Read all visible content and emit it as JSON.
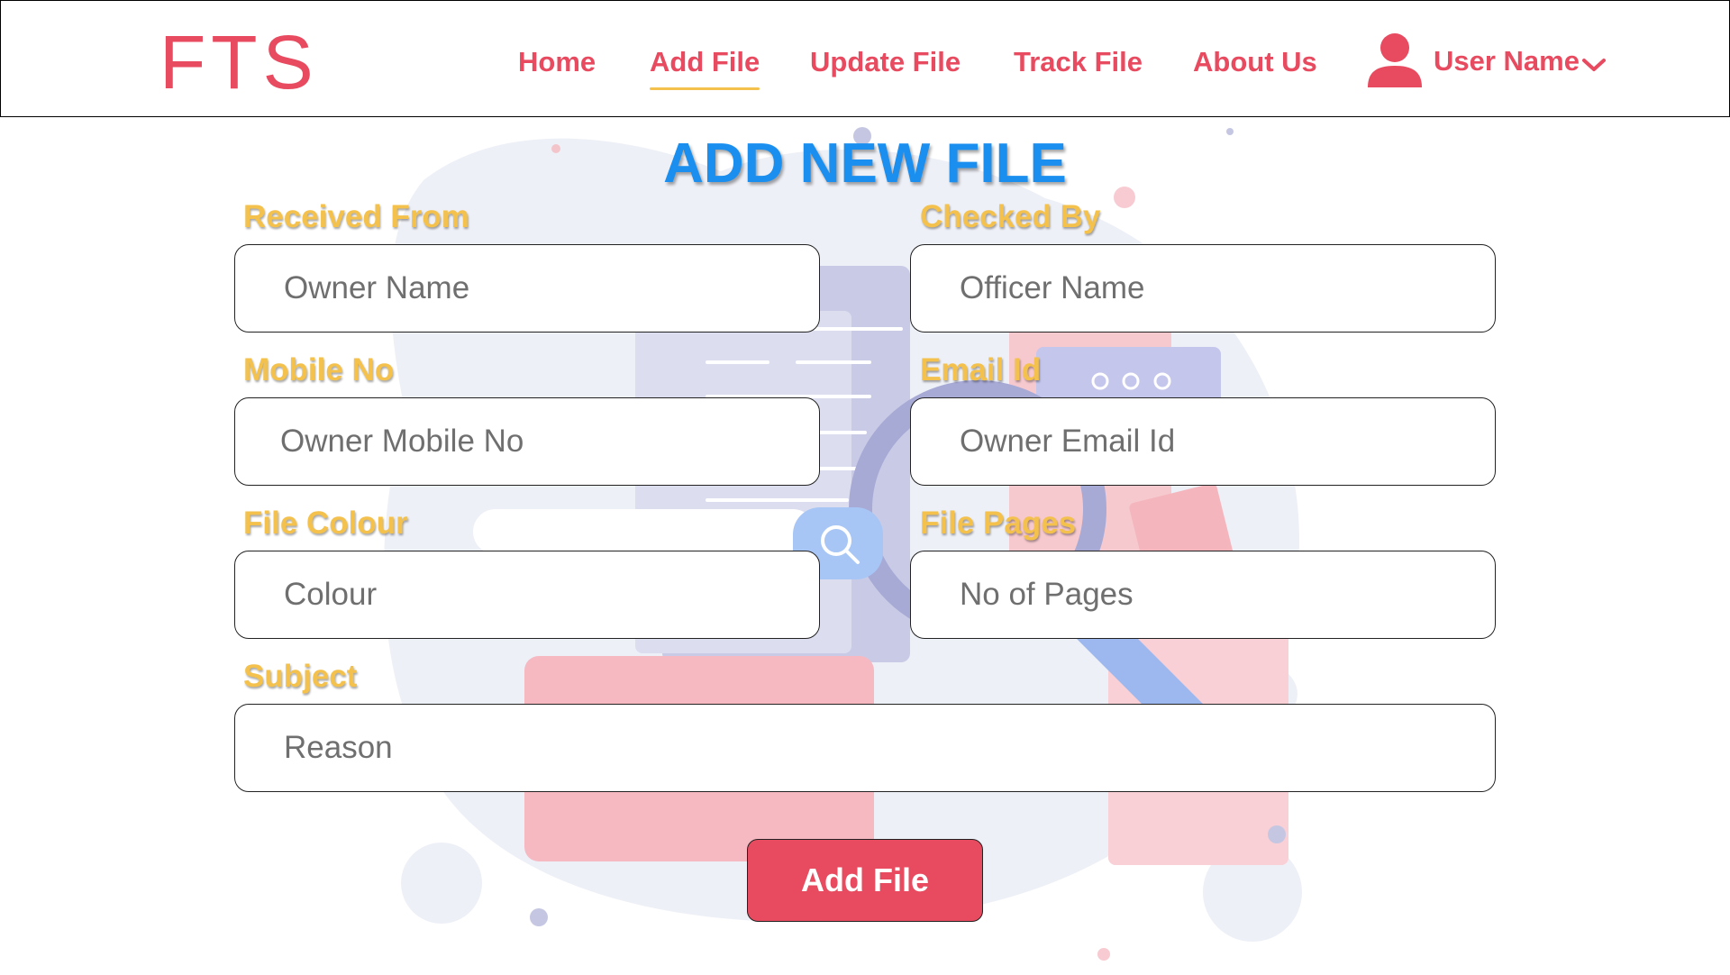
{
  "header": {
    "logo": "FTS",
    "nav": [
      {
        "label": "Home",
        "active": false
      },
      {
        "label": "Add File",
        "active": true
      },
      {
        "label": "Update File",
        "active": false
      },
      {
        "label": "Track File",
        "active": false
      },
      {
        "label": "About Us",
        "active": false
      }
    ],
    "user": {
      "name": "User Name",
      "icon": "user-icon",
      "dropdown_icon": "chevron-down-icon"
    }
  },
  "form": {
    "title": "ADD NEW FILE",
    "fields": {
      "received_from": {
        "label": "Received From",
        "placeholder": "Owner Name"
      },
      "checked_by": {
        "label": "Checked By",
        "placeholder": "Officer Name"
      },
      "mobile_no": {
        "label": "Mobile No",
        "placeholder": "Owner Mobile No"
      },
      "email_id": {
        "label": "Email Id",
        "placeholder": "Owner Email Id"
      },
      "file_colour": {
        "label": "File Colour",
        "placeholder": "Colour"
      },
      "file_pages": {
        "label": "File Pages",
        "placeholder": "No of Pages"
      },
      "subject": {
        "label": "Subject",
        "placeholder": "Reason"
      }
    },
    "submit_label": "Add File"
  },
  "colors": {
    "brand": "#e84a5f",
    "title": "#1a8ff0",
    "label": "#f3c14c",
    "active_underline": "#f3c14c"
  }
}
